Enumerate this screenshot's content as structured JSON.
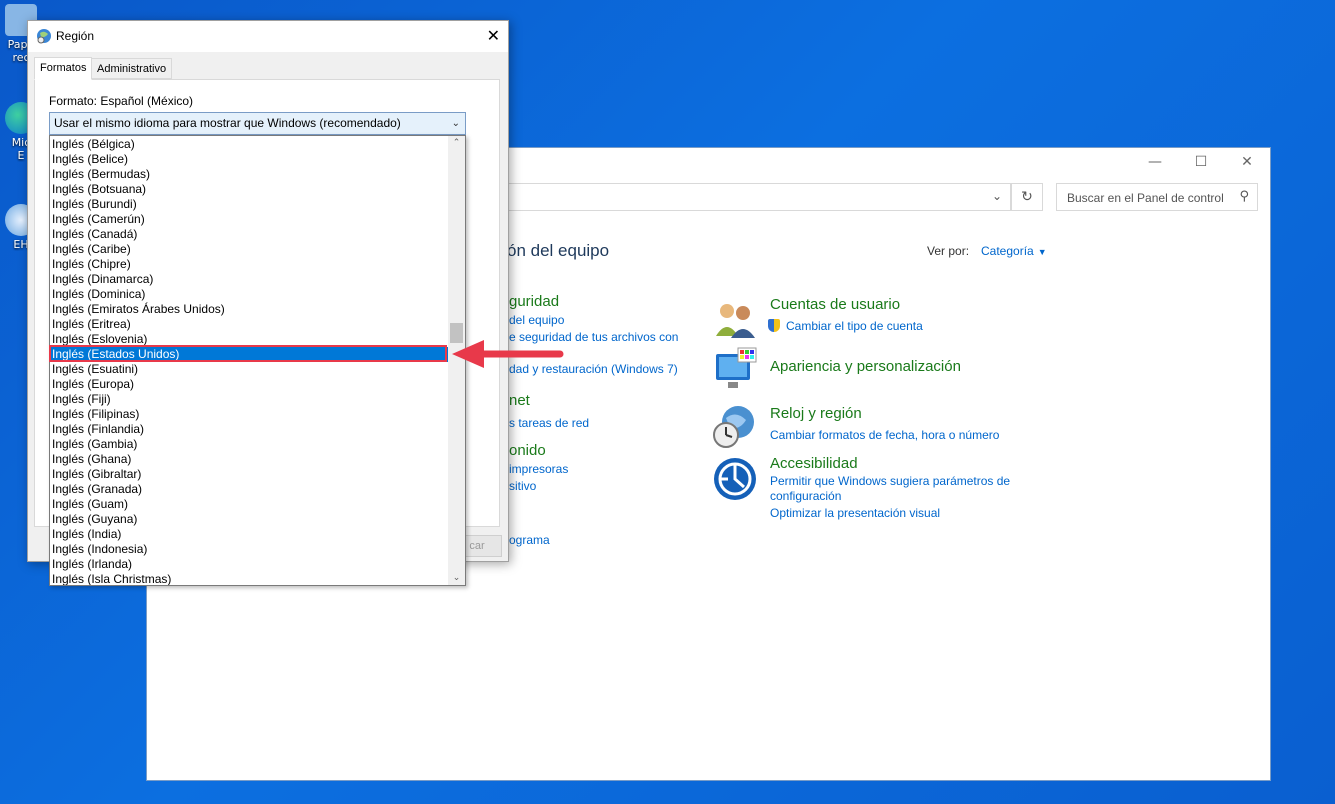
{
  "desktop": {
    "icons": [
      {
        "label": "Pape\nrec",
        "icon": "recycle-bin-icon"
      },
      {
        "label": "Mic\nE",
        "icon": "edge-icon"
      },
      {
        "label": "EH",
        "icon": "app-icon"
      }
    ]
  },
  "control_panel": {
    "window_buttons": {
      "minimize": "—",
      "maximize": "☐",
      "close": "✕"
    },
    "search_placeholder": "Buscar en el Panel de control",
    "heading": "ón del equipo",
    "view_by_label": "Ver por:",
    "view_by_value": "Categoría",
    "left_fragments": [
      "guridad",
      "del equipo",
      "e seguridad de tus archivos con",
      "dad y restauración (Windows 7)",
      "net",
      "s tareas de red",
      "onido",
      "impresoras",
      "sitivo",
      "ograma"
    ],
    "categories": [
      {
        "title": "Cuentas de usuario",
        "icon": "user-accounts-icon",
        "links": [
          "Cambiar el tipo de cuenta"
        ]
      },
      {
        "title": "Apariencia y personalización",
        "icon": "appearance-icon",
        "links": []
      },
      {
        "title": "Reloj y región",
        "icon": "clock-region-icon",
        "links": [
          "Cambiar formatos de fecha, hora o número"
        ]
      },
      {
        "title": "Accesibilidad",
        "icon": "accessibility-icon",
        "links": [
          "Permitir que Windows sugiera parámetros de configuración",
          "Optimizar la presentación visual"
        ]
      }
    ],
    "accent_green": "#1a7a1a",
    "link_blue": "#0066cc"
  },
  "region_dialog": {
    "title": "Región",
    "tabs": [
      "Formatos",
      "Administrativo"
    ],
    "format_label": "Formato: Español (México)",
    "combo_value": "Usar el mismo idioma para mostrar que Windows (recomendado)",
    "buttons": [
      "car"
    ],
    "options": [
      "Inglés (Bélgica)",
      "Inglés (Belice)",
      "Inglés (Bermudas)",
      "Inglés (Botsuana)",
      "Inglés (Burundi)",
      "Inglés (Camerún)",
      "Inglés (Canadá)",
      "Inglés (Caribe)",
      "Inglés (Chipre)",
      "Inglés (Dinamarca)",
      "Inglés (Dominica)",
      "Inglés (Emiratos Árabes Unidos)",
      "Inglés (Eritrea)",
      "Inglés (Eslovenia)",
      "Inglés (Estados Unidos)",
      "Inglés (Esuatini)",
      "Inglés (Europa)",
      "Inglés (Fiji)",
      "Inglés (Filipinas)",
      "Inglés (Finlandia)",
      "Inglés (Gambia)",
      "Inglés (Ghana)",
      "Inglés (Gibraltar)",
      "Inglés (Granada)",
      "Inglés (Guam)",
      "Inglés (Guyana)",
      "Inglés (India)",
      "Inglés (Indonesia)",
      "Inglés (Irlanda)",
      "Inglés (Isla Christmas)"
    ],
    "selected_option": "Inglés (Estados Unidos)",
    "highlight_color": "#e8394a",
    "selection_color": "#0078d7"
  }
}
